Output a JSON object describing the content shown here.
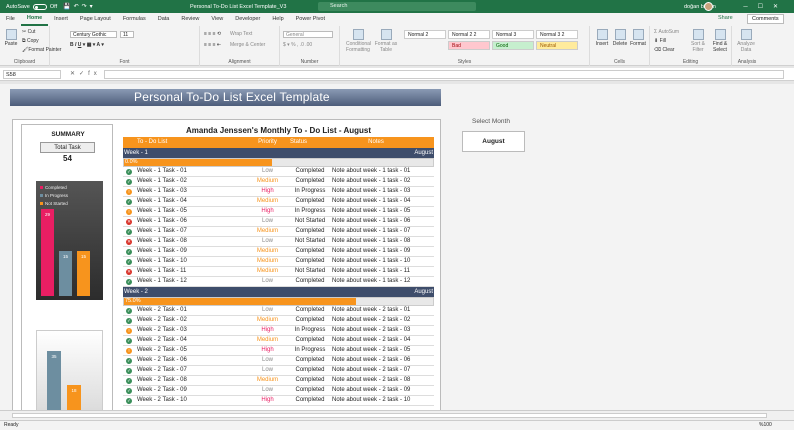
{
  "titlebar": {
    "autosave": "AutoSave",
    "autosave_state": "Off",
    "document_title": "Personal To-Do List Excel Template_V3",
    "search_placeholder": "Search",
    "user": "doğan bircan"
  },
  "tabs": [
    "File",
    "Home",
    "Insert",
    "Page Layout",
    "Formulas",
    "Data",
    "Review",
    "View",
    "Developer",
    "Help",
    "Power Pivot"
  ],
  "active_tab": "Home",
  "share_label": "Share",
  "comments_label": "Comments",
  "ribbon": {
    "clipboard": {
      "paste": "Paste",
      "cut": "Cut",
      "copy": "Copy",
      "format_painter": "Format Painter",
      "name": "Clipboard"
    },
    "font": {
      "font_name": "Century Gothic",
      "font_size": "11",
      "name": "Font"
    },
    "alignment": {
      "wrap": "Wrap Text",
      "merge": "Merge & Center",
      "name": "Alignment"
    },
    "number": {
      "format": "General",
      "name": "Number"
    },
    "styles": {
      "conditional": "Conditional Formatting",
      "format_table": "Format as Table",
      "cells": [
        "Normal 2",
        "Normal 2 2",
        "Normal 3",
        "Normal 3 2",
        "Bad",
        "Good",
        "Neutral"
      ],
      "name": "Styles"
    },
    "cells": {
      "insert": "Insert",
      "delete": "Delete",
      "format": "Format",
      "name": "Cells"
    },
    "editing": {
      "autosum": "AutoSum",
      "fill": "Fill",
      "clear": "Clear",
      "sort": "Sort & Filter",
      "find": "Find & Select",
      "name": "Editing"
    },
    "analysis": {
      "analyze": "Analyze Data",
      "name": "Analysis"
    }
  },
  "formula_bar": {
    "name_box": "S58",
    "fx": "fx",
    "formula": ""
  },
  "sheet": {
    "banner_title": "Personal To-Do List Excel Template",
    "select_month_label": "Select Month",
    "selected_month": "August",
    "summary": {
      "title": "SUMMARY",
      "total_label": "Total Task",
      "total_value": "54"
    },
    "todo_heading": "Amanda Jenssen's Monthly To - Do List - August",
    "columns": [
      "To - Do List",
      "Priority",
      "Status",
      "Notes"
    ],
    "weeks": [
      {
        "label": "Week - 1",
        "month": "August",
        "pct": "0.0%",
        "tasks": [
          {
            "icon": "check",
            "task": "Week - 1 Task - 01",
            "priority": "Low",
            "status": "Completed",
            "note": "Note about week - 1 task - 01"
          },
          {
            "icon": "check",
            "task": "Week - 1 Task - 02",
            "priority": "Medium",
            "status": "Completed",
            "note": "Note about week - 1 task - 02"
          },
          {
            "icon": "progress",
            "task": "Week - 1 Task - 03",
            "priority": "High",
            "status": "In Progress",
            "note": "Note about week - 1 task - 03"
          },
          {
            "icon": "check",
            "task": "Week - 1 Task - 04",
            "priority": "Medium",
            "status": "Completed",
            "note": "Note about week - 1 task - 04"
          },
          {
            "icon": "progress",
            "task": "Week - 1 Task - 05",
            "priority": "High",
            "status": "In Progress",
            "note": "Note about week - 1 task - 05"
          },
          {
            "icon": "cross",
            "task": "Week - 1 Task - 06",
            "priority": "Low",
            "status": "Not Started",
            "note": "Note about week - 1 task - 06"
          },
          {
            "icon": "check",
            "task": "Week - 1 Task - 07",
            "priority": "Medium",
            "status": "Completed",
            "note": "Note about week - 1 task - 07"
          },
          {
            "icon": "cross",
            "task": "Week - 1 Task - 08",
            "priority": "Low",
            "status": "Not Started",
            "note": "Note about week - 1 task - 08"
          },
          {
            "icon": "check",
            "task": "Week - 1 Task - 09",
            "priority": "Medium",
            "status": "Completed",
            "note": "Note about week - 1 task - 09"
          },
          {
            "icon": "check",
            "task": "Week - 1 Task - 10",
            "priority": "Medium",
            "status": "Completed",
            "note": "Note about week - 1 task - 10"
          },
          {
            "icon": "cross",
            "task": "Week - 1 Task - 11",
            "priority": "Medium",
            "status": "Not Started",
            "note": "Note about week - 1 task - 11"
          },
          {
            "icon": "check",
            "task": "Week - 1 Task - 12",
            "priority": "Low",
            "status": "Completed",
            "note": "Note about week - 1 task - 12"
          }
        ]
      },
      {
        "label": "Week - 2",
        "month": "August",
        "pct": "75.0%",
        "tasks": [
          {
            "icon": "check",
            "task": "Week - 2 Task - 01",
            "priority": "Low",
            "status": "Completed",
            "note": "Note about week - 2 task - 01"
          },
          {
            "icon": "check",
            "task": "Week - 2 Task - 02",
            "priority": "Medium",
            "status": "Completed",
            "note": "Note about week - 2 task - 02"
          },
          {
            "icon": "progress",
            "task": "Week - 2 Task - 03",
            "priority": "High",
            "status": "In Progress",
            "note": "Note about week - 2 task - 03"
          },
          {
            "icon": "check",
            "task": "Week - 2 Task - 04",
            "priority": "Medium",
            "status": "Completed",
            "note": "Note about week - 2 task - 04"
          },
          {
            "icon": "progress",
            "task": "Week - 2 Task - 05",
            "priority": "High",
            "status": "In Progress",
            "note": "Note about week - 2 task - 05"
          },
          {
            "icon": "check",
            "task": "Week - 2 Task - 06",
            "priority": "Low",
            "status": "Completed",
            "note": "Note about week - 2 task - 06"
          },
          {
            "icon": "check",
            "task": "Week - 2 Task - 07",
            "priority": "Low",
            "status": "Completed",
            "note": "Note about week - 2 task - 07"
          },
          {
            "icon": "check",
            "task": "Week - 2 Task - 08",
            "priority": "Medium",
            "status": "Completed",
            "note": "Note about week - 2 task - 08"
          },
          {
            "icon": "check",
            "task": "Week - 2 Task - 09",
            "priority": "Low",
            "status": "Completed",
            "note": "Note about week - 2 task - 09"
          },
          {
            "icon": "check",
            "task": "Week - 2 Task - 10",
            "priority": "High",
            "status": "Completed",
            "note": "Note about week - 2 task - 10"
          }
        ]
      }
    ]
  },
  "priority_colors": {
    "Low": "#8a8a8a",
    "Medium": "#f7941d",
    "High": "#e91e63"
  },
  "status_icon_colors": {
    "check": "#3a8f5a",
    "progress": "#f7941d",
    "cross": "#d9342b"
  },
  "chart_data": [
    {
      "type": "bar",
      "categories": [
        "Completed",
        "In Progress",
        "Not Started"
      ],
      "values": [
        29,
        15,
        15
      ],
      "colors": [
        "#e91e63",
        "#6d8ea0",
        "#f7941d"
      ],
      "legend": [
        "Completed",
        "In Progress",
        "Not Started"
      ],
      "legend_position": "top-left",
      "ylim": [
        0,
        35
      ]
    },
    {
      "type": "bar",
      "categories": [
        "",
        ""
      ],
      "values": [
        35,
        18
      ],
      "colors": [
        "#6d8ea0",
        "#f7941d"
      ],
      "ylim": [
        0,
        40
      ]
    }
  ],
  "status_bar": {
    "ready": "Ready",
    "zoom": "%100"
  }
}
